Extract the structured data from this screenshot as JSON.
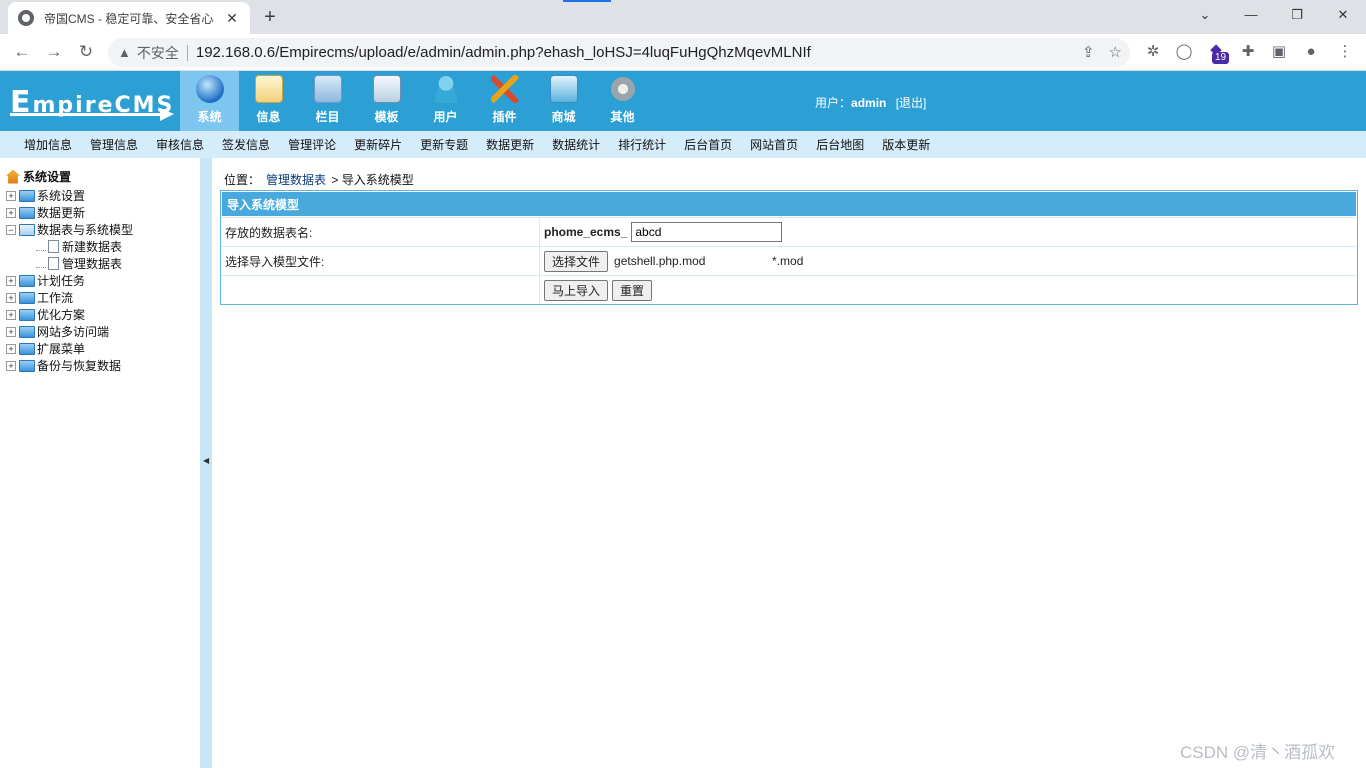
{
  "browser": {
    "tab_title": "帝国CMS - 稳定可靠、安全省心",
    "tab_close": "✕",
    "new_tab": "+",
    "insecure_label": "不安全",
    "url": "192.168.0.6/Empirecms/upload/e/admin/admin.php?ehash_loHSJ=4luqFuHgQhzMqevMLNIf",
    "extension_badge": "19",
    "icons": [
      "back-icon",
      "forward-icon",
      "reload-icon",
      "share-icon",
      "star-icon",
      "extensions-icon",
      "sidepanel-icon",
      "profile-icon",
      "menu-icon"
    ]
  },
  "app": {
    "logo": {
      "first": "E",
      "rest": "mpireCMS"
    },
    "nav": [
      {
        "label": "系统",
        "icon": "globe-icon",
        "active": true
      },
      {
        "label": "信息",
        "icon": "notepad-icon"
      },
      {
        "label": "栏目",
        "icon": "folder-icon"
      },
      {
        "label": "模板",
        "icon": "window-icon"
      },
      {
        "label": "用户",
        "icon": "user-icon"
      },
      {
        "label": "插件",
        "icon": "tools-icon"
      },
      {
        "label": "商城",
        "icon": "shop-icon"
      },
      {
        "label": "其他",
        "icon": "gear-icon"
      }
    ],
    "user_label": "用户：",
    "username": "admin",
    "logout": "[退出]",
    "accent": "#2c9fd4",
    "submenu": [
      "增加信息",
      "管理信息",
      "审核信息",
      "签发信息",
      "管理评论",
      "更新碎片",
      "更新专题",
      "数据更新",
      "数据统计",
      "排行统计",
      "后台首页",
      "网站首页",
      "后台地图",
      "版本更新"
    ]
  },
  "tree": {
    "root": "系统设置",
    "items": [
      {
        "label": "系统设置",
        "type": "folder"
      },
      {
        "label": "数据更新",
        "type": "folder"
      },
      {
        "label": "数据表与系统模型",
        "type": "folder-open"
      },
      {
        "label": "新建数据表",
        "type": "doc"
      },
      {
        "label": "管理数据表",
        "type": "doc"
      },
      {
        "label": "计划任务",
        "type": "folder"
      },
      {
        "label": "工作流",
        "type": "folder"
      },
      {
        "label": "优化方案",
        "type": "folder"
      },
      {
        "label": "网站多访问端",
        "type": "folder"
      },
      {
        "label": "扩展菜单",
        "type": "folder"
      },
      {
        "label": "备份与恢复数据",
        "type": "folder"
      }
    ]
  },
  "main": {
    "crumb_prefix": "位置：",
    "crumb_link": "管理数据表",
    "crumb_sep": ">",
    "crumb_current": "导入系统模型",
    "form_title": "导入系统模型",
    "table_label": "存放的数据表名:",
    "table_prefix": "phome_ecms_",
    "table_value": "abcd",
    "file_label": "选择导入模型文件:",
    "choose_file": "选择文件",
    "file_name": "getshell.php.mod",
    "file_ext": "*.mod",
    "submit": "马上导入",
    "reset": "重置"
  },
  "watermark": "CSDN @清丶酒孤欢"
}
